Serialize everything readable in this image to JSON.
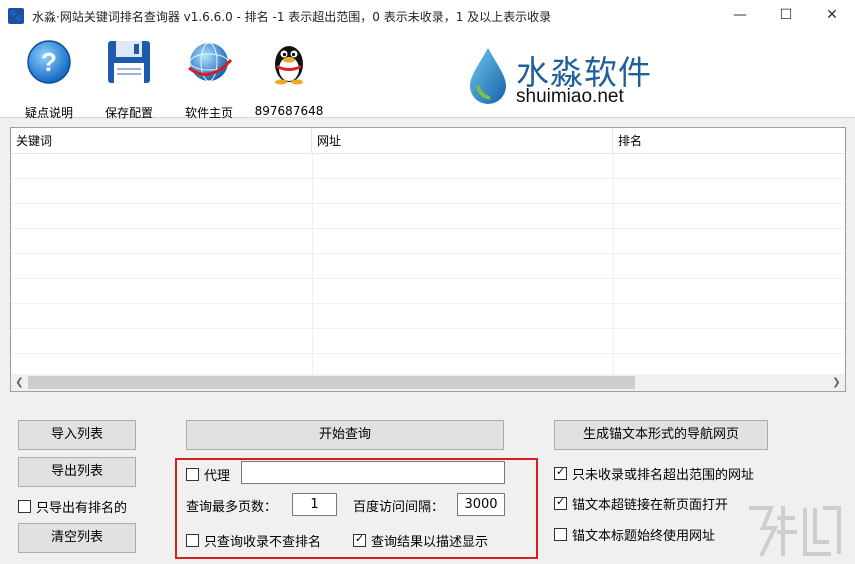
{
  "window": {
    "app_icon": "paw-icon",
    "title": "水淼·网站关键词排名查询器 v1.6.6.0 - 排名 -1 表示超出范围，0 表示未收录，1 及以上表示收录",
    "controls": {
      "minimize": "—",
      "maximize": "☐",
      "close": "✕"
    }
  },
  "toolbar": {
    "items": [
      {
        "label": "疑点说明",
        "icon": "help-icon"
      },
      {
        "label": "保存配置",
        "icon": "floppy-disk-icon"
      },
      {
        "label": "软件主页",
        "icon": "globe-icon"
      },
      {
        "label": "897687648",
        "icon": "qq-penguin-icon"
      }
    ]
  },
  "logo": {
    "cn": "水淼软件",
    "en": "shuimiao.net",
    "icon": "water-drop-icon"
  },
  "table": {
    "columns": [
      "关键词",
      "网址",
      "排名"
    ],
    "rows": []
  },
  "left_panel": {
    "import": "导入列表",
    "export": "导出列表",
    "export_ranked_only": {
      "label": "只导出有排名的",
      "checked": false
    },
    "clear": "清空列表"
  },
  "center_panel": {
    "start": "开始查询",
    "proxy": {
      "label": "代理",
      "checked": false,
      "value": ""
    },
    "max_pages": {
      "label": "查询最多页数：",
      "value": "1"
    },
    "interval": {
      "label": "百度访问间隔：",
      "value": "3000"
    },
    "index_only": {
      "label": "只查询收录不查排名",
      "checked": false
    },
    "desc_display": {
      "label": "查询结果以描述显示",
      "checked": true
    }
  },
  "right_panel": {
    "generate": "生成锚文本形式的导航网页",
    "only_unindexed": {
      "label": "只未收录或排名超出范围的网址",
      "checked": true
    },
    "new_window": {
      "label": "锚文本超链接在新页面打开",
      "checked": true
    },
    "title_url": {
      "label": "锚文本标题始终使用网址",
      "checked": false
    }
  }
}
